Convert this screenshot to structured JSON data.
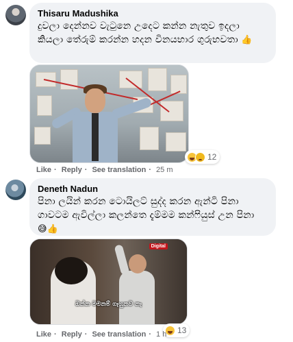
{
  "comments": [
    {
      "author": "Thisaru Madushika",
      "text": "දුවලා දෙන්නව වැටුනෙ උදෙට කන්න නැතුව ඉදලා කියලා තේරුම් කරන්න හදන විනයභාර ගුරුභවතා",
      "inline_emoji": "👍",
      "actions": {
        "like": "Like",
        "reply": "Reply",
        "translate": "See translation",
        "time": "25 m"
      },
      "reaction_count": "12",
      "reaction_icons": [
        "haha-icon",
        "sad-icon"
      ]
    },
    {
      "author": "Deneth Nadun",
      "text": "පිනා ලයින් කරන ටොයිලට් සුද්ද කරන ඇන්ටි පිනා ගාවටම ඇවිල්ලා කලන්තෙ දැම්මම කන්ෆියුස් උන පිනා",
      "inline_emoji": "😅👍",
      "actions": {
        "like": "Like",
        "reply": "Reply",
        "translate": "See translation",
        "time": "1 h"
      },
      "reaction_count": "13",
      "reaction_icons": [
        "haha-icon"
      ],
      "image_caption": "ඔන්න මමනම් ගෑහුනව නෑ",
      "image_logo": "Digital"
    }
  ],
  "colors": {
    "bubble": "#f0f2f5",
    "meta_text": "#65676b",
    "name_text": "#050505"
  }
}
